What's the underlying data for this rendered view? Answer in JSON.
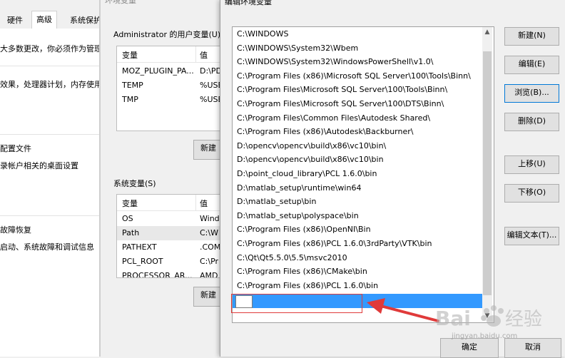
{
  "sys_properties": {
    "tabs": [
      "硬件",
      "高级",
      "系统保护"
    ],
    "active_tab": "高级",
    "intro_text": "大多数更改，你必须作为管理员登录",
    "perf_text": "效果，处理器计划，内存使用",
    "profile_title": "配置文件",
    "profile_text": "录帐户相关的桌面设置",
    "startup_title": "故障恢复",
    "startup_text": "启动、系统故障和调试信息"
  },
  "env_vars": {
    "title": "环境变量",
    "user_group": "Administrator 的用户变量(U)",
    "col_variable": "变量",
    "col_value": "值",
    "user_rows": [
      {
        "name": "MOZ_PLUGIN_PA...",
        "value": "D:\\PD"
      },
      {
        "name": "TEMP",
        "value": "%USE"
      },
      {
        "name": "TMP",
        "value": "%USE"
      }
    ],
    "user_new_button": "新建",
    "system_group": "系统变量(S)",
    "system_rows": [
      {
        "name": "OS",
        "value": "Wind"
      },
      {
        "name": "Path",
        "value": "C:\\W"
      },
      {
        "name": "PATHEXT",
        "value": ".COM"
      },
      {
        "name": "PCL_ROOT",
        "value": "C:\\Pr"
      },
      {
        "name": "PROCESSOR_AR...",
        "value": "AMD"
      }
    ],
    "system_new_button": "新建"
  },
  "edit_dialog": {
    "title": "编辑环境变量",
    "paths": [
      "C:\\WINDOWS",
      "C:\\WINDOWS\\System32\\Wbem",
      "C:\\WINDOWS\\System32\\WindowsPowerShell\\v1.0\\",
      "C:\\Program Files (x86)\\Microsoft SQL Server\\100\\Tools\\Binn\\",
      "C:\\Program Files\\Microsoft SQL Server\\100\\Tools\\Binn\\",
      "C:\\Program Files\\Microsoft SQL Server\\100\\DTS\\Binn\\",
      "C:\\Program Files\\Common Files\\Autodesk Shared\\",
      "C:\\Program Files (x86)\\Autodesk\\Backburner\\",
      "D:\\opencv\\opencv\\build\\x86\\vc10\\bin\\",
      "D:\\opencv\\opencv\\build\\x86\\vc10\\bin",
      "D:\\point_cloud_library\\PCL 1.6.0\\bin",
      "D:\\matlab_setup\\runtime\\win64",
      "D:\\matlab_setup\\bin",
      "D:\\matlab_setup\\polyspace\\bin",
      "C:\\Program Files (x86)\\OpenNI\\Bin",
      "C:\\Program Files (x86)\\PCL 1.6.0\\3rdParty\\VTK\\bin",
      "C:\\Qt\\Qt5.5.0\\5.5\\msvc2010",
      "C:\\Program Files (x86)\\CMake\\bin",
      "C:\\Program Files (x86)\\PCL 1.6.0\\bin"
    ],
    "new_entry_value": "",
    "buttons": {
      "new": "新建(N)",
      "edit": "编辑(E)",
      "browse": "浏览(B)...",
      "delete": "删除(D)",
      "move_up": "上移(U)",
      "move_down": "下移(O)",
      "edit_text": "编辑文本(T)...",
      "ok": "确定",
      "cancel": "取消"
    },
    "selection_color": "#3399ff"
  },
  "annotation": {
    "color": "#e03a3a"
  },
  "watermark": {
    "text": "Bai",
    "text2": "经验",
    "subtext": "jingyan.baidu.com"
  }
}
